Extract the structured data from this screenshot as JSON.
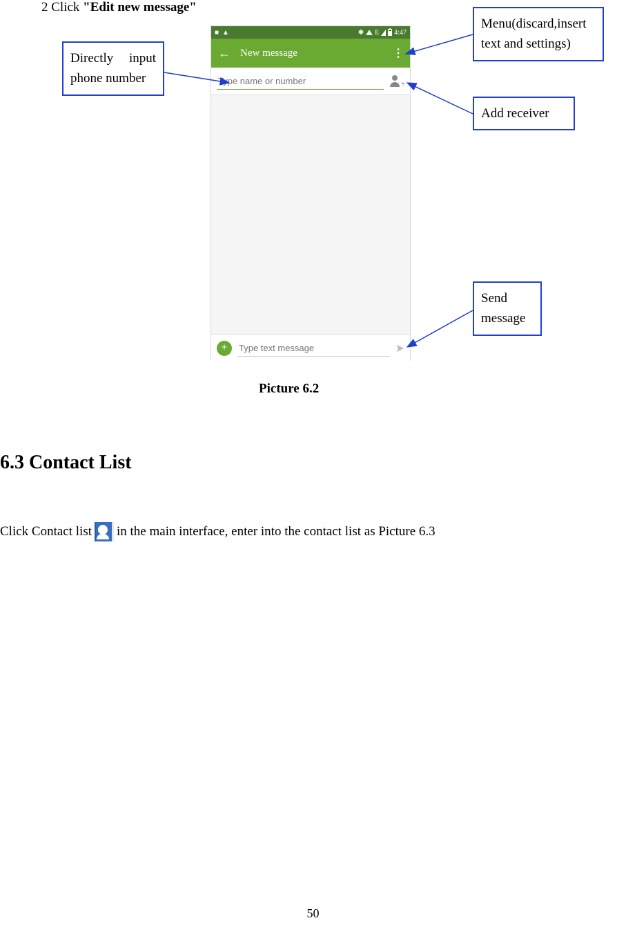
{
  "step": {
    "prefix": "2 Click ",
    "bold": "\"Edit new message\""
  },
  "caption": "Picture 6.2",
  "section": {
    "heading": "6.3 Contact List",
    "body_before": "Click Contact list ",
    "body_after": " in the main interface, enter into the contact list as Picture 6.3"
  },
  "page_number": "50",
  "callouts": {
    "menu": "Menu(discard,insert text and settings)",
    "input": "Directly  input phone number",
    "add": "Add receiver",
    "send": "Send message"
  },
  "phone": {
    "status": {
      "sim_icon": "■",
      "warn_icon": "▲",
      "bt_icon": "✱",
      "signal_icon": "◢",
      "wifi_label": "E",
      "data_icon": "◢",
      "time": "4:47"
    },
    "appbar": {
      "back": "←",
      "title": "New message",
      "menu": "⋮"
    },
    "recipient_placeholder": "Type name or number",
    "compose": {
      "add_glyph": "+",
      "placeholder": "Type text message",
      "send_glyph": "➤"
    }
  }
}
